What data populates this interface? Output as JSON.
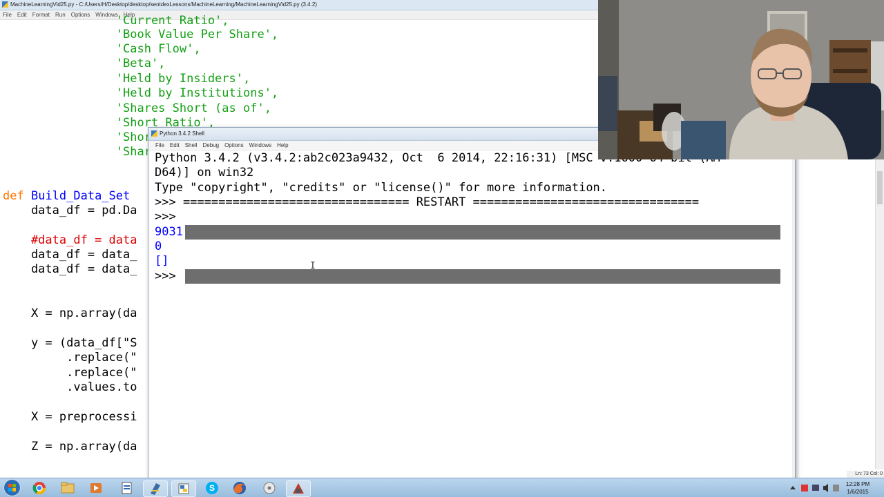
{
  "editor": {
    "title": "MachineLearningVid25.py - C:/Users/H/Desktop/desktop/sentdexLessons/MachineLearning/MachineLearningVid25.py (3.4.2)",
    "menu": [
      "File",
      "Edit",
      "Format",
      "Run",
      "Options",
      "Windows",
      "Help"
    ],
    "lines": [
      {
        "indent": "                ",
        "text": "'Current Ratio',"
      },
      {
        "indent": "                ",
        "text": "'Book Value Per Share',"
      },
      {
        "indent": "                ",
        "text": "'Cash Flow',"
      },
      {
        "indent": "                ",
        "text": "'Beta',"
      },
      {
        "indent": "                ",
        "text": "'Held by Insiders',"
      },
      {
        "indent": "                ",
        "text": "'Held by Institutions',"
      },
      {
        "indent": "                ",
        "text": "'Shares Short (as of',"
      },
      {
        "indent": "                ",
        "text": "'Short Ratio',"
      },
      {
        "indent": "                ",
        "text": "'Short"
      },
      {
        "indent": "                ",
        "text": "'Share"
      }
    ],
    "def_kw": "def",
    "def_name": "Build_Data_Set",
    "body": [
      "    data_df = pd.Da",
      "    #data_df = data",
      "    data_df = data_",
      "    data_df = data_",
      "    X = np.array(da",
      "    y = (data_df[\"S",
      "         .replace(\"",
      "         .replace(\"",
      "         .values.to",
      "    X = preprocessi",
      "    Z = np.array(da"
    ],
    "status": "Ln: 73  Col: 0"
  },
  "shell": {
    "title": "Python 3.4.2 Shell",
    "menu": [
      "File",
      "Edit",
      "Shell",
      "Debug",
      "Options",
      "Windows",
      "Help"
    ],
    "banner1": "Python 3.4.2 (v3.4.2:ab2c023a9432, Oct  6 2014, 22:16:31) [MSC v.1600 64 bit (AM",
    "banner2": "D64)] on win32",
    "banner3": "Type \"copyright\", \"credits\" or \"license()\" for more information.",
    "restart": ">>> ================================ RESTART ================================",
    "prompt": ">>>",
    "output1": "9031",
    "output2": "0",
    "output3": "[]"
  },
  "taskbar": {
    "time": "12:28 PM",
    "date": "1/6/2015",
    "apps": [
      "start",
      "chrome",
      "file-explorer",
      "media-player",
      "pdf",
      "idle-editor",
      "python-shell",
      "skype",
      "firefox",
      "disk-tool",
      "camera-app"
    ]
  },
  "colors": {
    "string": "#13a013",
    "keyword": "#ff7700",
    "function": "#0000ff",
    "comment": "#dd0000",
    "output": "#0000ff",
    "selection": "#6e6e6e"
  }
}
